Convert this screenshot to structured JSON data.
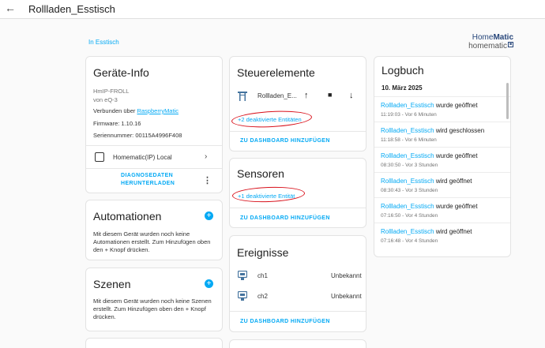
{
  "header": {
    "title": "Rollladen_Esstisch"
  },
  "area_link": "In Esstisch",
  "logo": {
    "line1_a": "Home",
    "line1_b": "Matic",
    "line2": "homematic"
  },
  "device_info": {
    "title": "Geräte-Info",
    "model": "HmIP-FROLL",
    "vendor": "von eQ-3",
    "connected_prefix": "Verbunden über ",
    "connected_link": "RaspberryMatic",
    "firmware": "Firmware: 1.10.16",
    "serial": "Seriennummer: 00115A4996F408",
    "integration": "Homematic(IP) Local",
    "download_line1": "DIAGNOSEDATEN",
    "download_line2": "HERUNTERLADEN"
  },
  "automations": {
    "title": "Automationen",
    "text": "Mit diesem Gerät wurden noch keine Automationen erstellt. Zum Hinzufügen oben den + Knopf drücken."
  },
  "scenes": {
    "title": "Szenen",
    "text": "Mit diesem Gerät wurden noch keine Szenen erstellt. Zum Hinzufügen oben den + Knopf drücken."
  },
  "controls": {
    "title": "Steuerelemente",
    "entity_name": "Rollladen_E...",
    "disabled": "+2 deaktivierte Entitäten",
    "add_dashboard": "ZU DASHBOARD HINZUFÜGEN"
  },
  "sensors": {
    "title": "Sensoren",
    "disabled": "+1 deaktivierte Entität",
    "add_dashboard": "ZU DASHBOARD HINZUFÜGEN"
  },
  "events": {
    "title": "Ereignisse",
    "rows": [
      {
        "name": "ch1",
        "state": "Unbekannt"
      },
      {
        "name": "ch2",
        "state": "Unbekannt"
      }
    ],
    "add_dashboard": "ZU DASHBOARD HINZUFÜGEN"
  },
  "logbook": {
    "title": "Logbuch",
    "date": "10. März 2025",
    "entries": [
      {
        "entity": "Rollladen_Esstisch",
        "action": " wurde geöffnet",
        "time": "11:19:03 - Vor 6 Minuten"
      },
      {
        "entity": "Rollladen_Esstisch",
        "action": " wird geschlossen",
        "time": "11:18:58 - Vor 6 Minuten"
      },
      {
        "entity": "Rollladen_Esstisch",
        "action": " wurde geöffnet",
        "time": "08:30:50 - Vor 3 Stunden"
      },
      {
        "entity": "Rollladen_Esstisch",
        "action": " wird geöffnet",
        "time": "08:30:43 - Vor 3 Stunden"
      },
      {
        "entity": "Rollladen_Esstisch",
        "action": " wurde geöffnet",
        "time": "07:16:50 - Vor 4 Stunden"
      },
      {
        "entity": "Rollladen_Esstisch",
        "action": " wird geöffnet",
        "time": "07:16:48 - Vor 4 Stunden"
      }
    ]
  },
  "colors": {
    "accent": "#03a9f4",
    "annotation": "#d8101a"
  }
}
